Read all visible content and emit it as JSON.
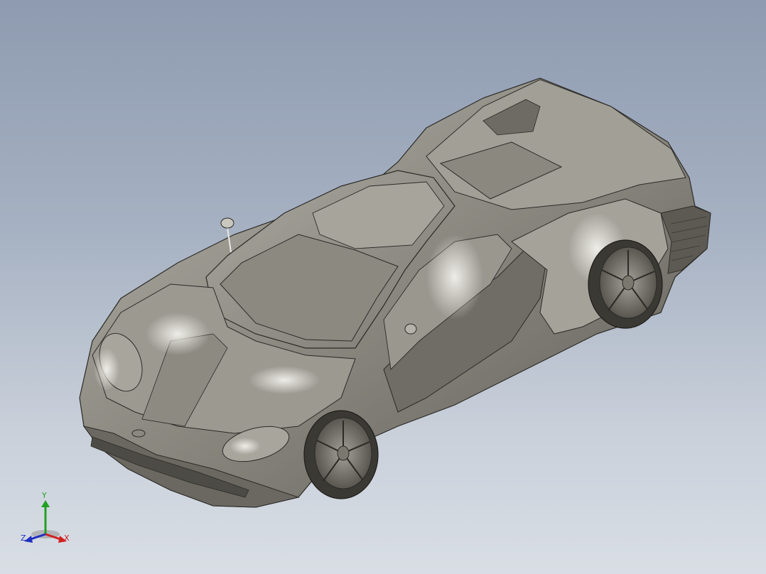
{
  "viewport": {
    "background_top": "#8e9bb0",
    "background_bottom": "#d9dee5",
    "model_color": "#8f8d84"
  },
  "triad": {
    "x_label": "X",
    "y_label": "Y",
    "z_label": "Z",
    "x_color": "#d02020",
    "y_color": "#22a022",
    "z_color": "#2030c0"
  }
}
